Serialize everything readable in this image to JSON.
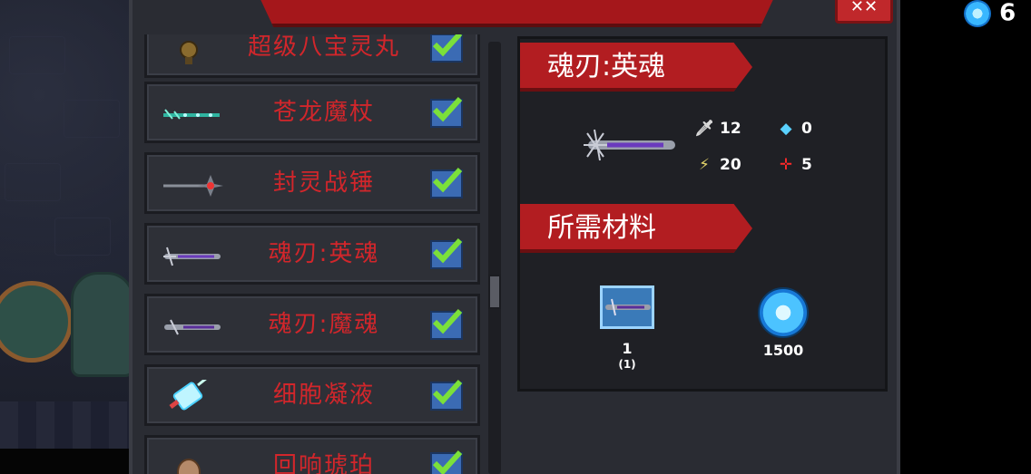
{
  "title_bar": {
    "close_label": "✕✕"
  },
  "currency": {
    "icon": "blue-gem-icon",
    "value": "6"
  },
  "list": {
    "items": [
      {
        "name": "超级八宝灵丸",
        "icon": "pill-icon",
        "checked": true
      },
      {
        "name": "苍龙魔杖",
        "icon": "staff-icon",
        "checked": true
      },
      {
        "name": "封灵战锤",
        "icon": "hammer-icon",
        "checked": true
      },
      {
        "name": "魂刃:英魂",
        "icon": "purple-blade-icon",
        "checked": true
      },
      {
        "name": "魂刃:魔魂",
        "icon": "purple-blade-icon",
        "checked": true
      },
      {
        "name": "细胞凝液",
        "icon": "syringe-icon",
        "checked": true
      },
      {
        "name": "回响琥珀",
        "icon": "amber-icon",
        "checked": true
      }
    ]
  },
  "detail": {
    "item_title": "魂刃:英魂",
    "stats": {
      "attack": "12",
      "energy": "0",
      "crit": "20",
      "precision": "5"
    },
    "materials_title": "所需材料",
    "materials": [
      {
        "icon": "blade-blueprint-icon",
        "count": "1",
        "owned": "(1)"
      },
      {
        "icon": "blue-gem-icon",
        "count": "1500"
      }
    ]
  }
}
